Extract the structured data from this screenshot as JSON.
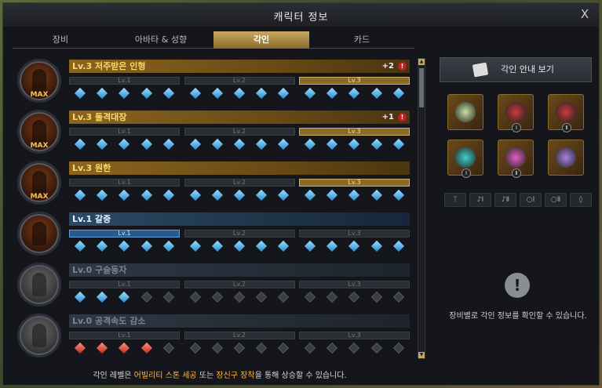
{
  "window": {
    "title": "캐릭터 정보",
    "close_label": "X"
  },
  "tabs": [
    {
      "label": "장비"
    },
    {
      "label": "아바타 & 성향"
    },
    {
      "label": "각인"
    },
    {
      "label": "카드"
    }
  ],
  "active_tab": 2,
  "level_labels": [
    "Lv.1",
    "Lv.2",
    "Lv.3"
  ],
  "engravings": [
    {
      "title": "Lv.3 저주받은 인형",
      "bonus": "+2",
      "max": "MAX",
      "style": "gold",
      "warning": "!",
      "active_level": 3,
      "nodes": [
        "blue",
        "blue",
        "blue",
        "blue",
        "blue",
        "blue",
        "blue",
        "blue",
        "blue",
        "blue",
        "blue",
        "blue",
        "blue",
        "blue",
        "blue"
      ]
    },
    {
      "title": "Lv.3 돌격대장",
      "bonus": "+1",
      "max": "MAX",
      "style": "gold",
      "warning": "!",
      "active_level": 3,
      "nodes": [
        "blue",
        "blue",
        "blue",
        "blue",
        "blue",
        "blue",
        "blue",
        "blue",
        "blue",
        "blue",
        "blue",
        "blue",
        "blue",
        "blue",
        "blue"
      ]
    },
    {
      "title": "Lv.3 원한",
      "bonus": "",
      "max": "MAX",
      "style": "gold",
      "warning": "",
      "active_level": 3,
      "nodes": [
        "blue",
        "blue",
        "blue",
        "blue",
        "blue",
        "blue",
        "blue",
        "blue",
        "blue",
        "blue",
        "blue",
        "blue",
        "blue",
        "blue",
        "blue"
      ]
    },
    {
      "title": "Lv.1 갈증",
      "bonus": "",
      "max": "",
      "style": "blue",
      "warning": "",
      "active_level": 1,
      "nodes": [
        "blue",
        "blue",
        "blue",
        "blue",
        "blue",
        "blue",
        "blue",
        "blue",
        "blue",
        "blue",
        "blue",
        "blue",
        "blue",
        "blue",
        "blue"
      ]
    },
    {
      "title": "Lv.0 구슬동자",
      "bonus": "",
      "max": "",
      "style": "gray",
      "warning": "",
      "active_level": 0,
      "nodes": [
        "blue",
        "blue",
        "blue",
        "empty",
        "empty",
        "empty",
        "empty",
        "empty",
        "empty",
        "empty",
        "empty",
        "empty",
        "empty",
        "empty",
        "empty"
      ]
    },
    {
      "title": "Lv.0 공격속도 감소",
      "bonus": "",
      "max": "",
      "style": "gray",
      "warning": "",
      "active_level": 0,
      "nodes": [
        "red",
        "red",
        "red",
        "red",
        "empty",
        "empty",
        "empty",
        "empty",
        "empty",
        "empty",
        "empty",
        "empty",
        "empty",
        "empty",
        "empty"
      ]
    }
  ],
  "guide_button": {
    "label": "각인 안내 보기"
  },
  "equipment": [
    {
      "name": "necklace",
      "color": "#c8e0a0",
      "tier": ""
    },
    {
      "name": "earring-1",
      "color": "#c83a3a",
      "tier": "Ⅰ"
    },
    {
      "name": "earring-2",
      "color": "#c83a3a",
      "tier": "Ⅱ"
    },
    {
      "name": "ring-1",
      "color": "#40d0c8",
      "tier": "Ⅰ"
    },
    {
      "name": "ring-2",
      "color": "#e060c0",
      "tier": "Ⅱ"
    },
    {
      "name": "stone",
      "color": "#a880e0",
      "tier": ""
    }
  ],
  "type_icons": [
    {
      "name": "necklace-filter",
      "glyph": "ᛉ"
    },
    {
      "name": "earring-1-filter",
      "glyph": "♪Ⅰ"
    },
    {
      "name": "earring-2-filter",
      "glyph": "♪Ⅱ"
    },
    {
      "name": "ring-1-filter",
      "glyph": "○Ⅰ"
    },
    {
      "name": "ring-2-filter",
      "glyph": "○Ⅱ"
    },
    {
      "name": "stone-filter",
      "glyph": "◊"
    }
  ],
  "info": {
    "icon": "!",
    "text": "장비별로 각인 정보를 확인할 수 있습니다."
  },
  "footer": {
    "prefix": "각인 레벨은 ",
    "hl1": "어빌리티 스톤 세공",
    "mid": " 또는 ",
    "hl2": "장신구 장착",
    "suffix": "을 통해 상승할 수 있습니다."
  },
  "scroll": {
    "up": "▲",
    "down": "▼"
  }
}
